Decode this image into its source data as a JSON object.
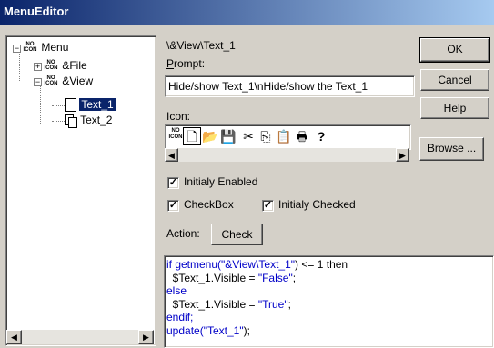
{
  "window": {
    "title": "MenuEditor"
  },
  "tree": {
    "root": "Menu",
    "file": "&File",
    "view": "&View",
    "text1": "Text_1",
    "text2": "Text_2",
    "noicon_top": "NO",
    "noicon_bottom": "ICON"
  },
  "path": "\\&View\\Text_1",
  "prompt": {
    "label_u": "P",
    "label_rest": "rompt:",
    "value": "Hide/show Text_1\\nHide/show the Text_1"
  },
  "icon": {
    "label": "Icon:"
  },
  "buttons": {
    "ok": "OK",
    "cancel": "Cancel",
    "help": "Help",
    "browse": "Browse ...",
    "check": "Check"
  },
  "options": {
    "initialy_enabled": "Initialy Enabled",
    "checkbox": "CheckBox",
    "initialy_checked": "Initialy Checked"
  },
  "action": {
    "label": "Action:"
  },
  "code": {
    "l1a": "if getmenu(",
    "l1b": "\"&View\\Text_1\"",
    "l1c": ") <= 1 then",
    "l2a": "  $Text_1.Visible = ",
    "l2b": "\"False\"",
    "l2c": ";",
    "l3": "else",
    "l4a": "  $Text_1.Visible = ",
    "l4b": "\"True\"",
    "l4c": ";",
    "l5": "endif;",
    "l6a": "update(",
    "l6b": "\"Text_1\"",
    "l6c": ");"
  }
}
